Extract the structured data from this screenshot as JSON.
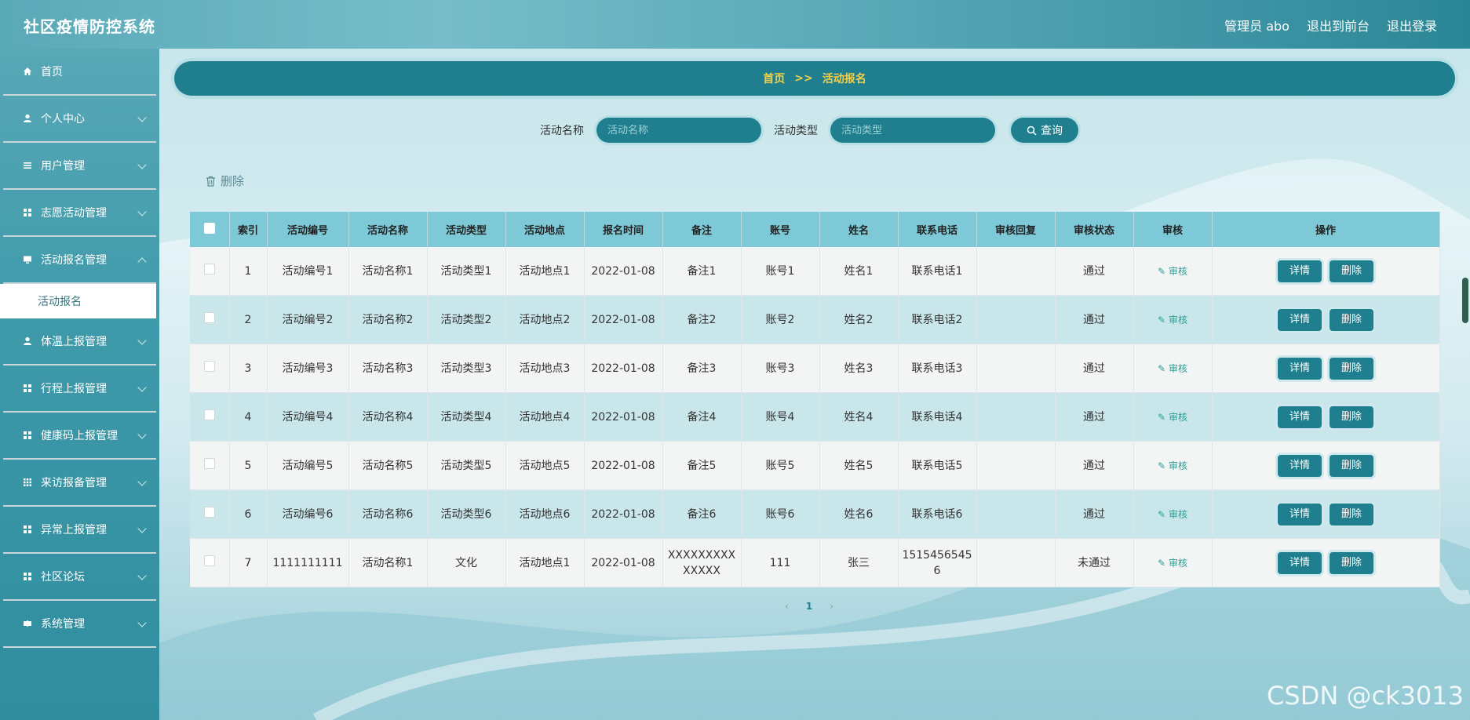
{
  "app": {
    "title": "社区疫情防控系统"
  },
  "topnav": {
    "user": "管理员 abo",
    "front": "退出到前台",
    "logout": "退出登录"
  },
  "sidebar": {
    "items": [
      {
        "label": "首页",
        "icon": "home-icon"
      },
      {
        "label": "个人中心",
        "icon": "user-icon"
      },
      {
        "label": "用户管理",
        "icon": "list-icon"
      },
      {
        "label": "志愿活动管理",
        "icon": "grid-icon"
      },
      {
        "label": "活动报名管理",
        "icon": "monitor-icon"
      },
      {
        "label": "体温上报管理",
        "icon": "user-icon"
      },
      {
        "label": "行程上报管理",
        "icon": "grid-icon"
      },
      {
        "label": "健康码上报管理",
        "icon": "grid-icon"
      },
      {
        "label": "来访报备管理",
        "icon": "apps-icon"
      },
      {
        "label": "异常上报管理",
        "icon": "grid-icon"
      },
      {
        "label": "社区论坛",
        "icon": "grid-icon"
      },
      {
        "label": "系统管理",
        "icon": "settings-icon"
      }
    ],
    "sub_active": "活动报名"
  },
  "breadcrumb": {
    "home": "首页",
    "sep": ">>",
    "current": "活动报名"
  },
  "search": {
    "name_label": "活动名称",
    "name_placeholder": "活动名称",
    "type_label": "活动类型",
    "type_placeholder": "活动类型",
    "query": "查询"
  },
  "toolbar": {
    "delete": "删除"
  },
  "table": {
    "headers": [
      "索引",
      "活动编号",
      "活动名称",
      "活动类型",
      "活动地点",
      "报名时间",
      "备注",
      "账号",
      "姓名",
      "联系电话",
      "审核回复",
      "审核状态",
      "审核",
      "操作"
    ],
    "audit_label": "审核",
    "detail_label": "详情",
    "delete_label": "删除",
    "rows": [
      [
        "1",
        "活动编号1",
        "活动名称1",
        "活动类型1",
        "活动地点1",
        "2022-01-08",
        "备注1",
        "账号1",
        "姓名1",
        "联系电话1",
        "",
        "通过"
      ],
      [
        "2",
        "活动编号2",
        "活动名称2",
        "活动类型2",
        "活动地点2",
        "2022-01-08",
        "备注2",
        "账号2",
        "姓名2",
        "联系电话2",
        "",
        "通过"
      ],
      [
        "3",
        "活动编号3",
        "活动名称3",
        "活动类型3",
        "活动地点3",
        "2022-01-08",
        "备注3",
        "账号3",
        "姓名3",
        "联系电话3",
        "",
        "通过"
      ],
      [
        "4",
        "活动编号4",
        "活动名称4",
        "活动类型4",
        "活动地点4",
        "2022-01-08",
        "备注4",
        "账号4",
        "姓名4",
        "联系电话4",
        "",
        "通过"
      ],
      [
        "5",
        "活动编号5",
        "活动名称5",
        "活动类型5",
        "活动地点5",
        "2022-01-08",
        "备注5",
        "账号5",
        "姓名5",
        "联系电话5",
        "",
        "通过"
      ],
      [
        "6",
        "活动编号6",
        "活动名称6",
        "活动类型6",
        "活动地点6",
        "2022-01-08",
        "备注6",
        "账号6",
        "姓名6",
        "联系电话6",
        "",
        "通过"
      ],
      [
        "7",
        "1111111111",
        "活动名称1",
        "文化",
        "活动地点1",
        "2022-01-08",
        "XXXXXXXXXXXXXX",
        "111",
        "张三",
        "15154565456",
        "",
        "未通过"
      ]
    ]
  },
  "pager": {
    "prev": "‹",
    "page": "1",
    "next": "›"
  },
  "watermark": "CSDN @ck3013"
}
